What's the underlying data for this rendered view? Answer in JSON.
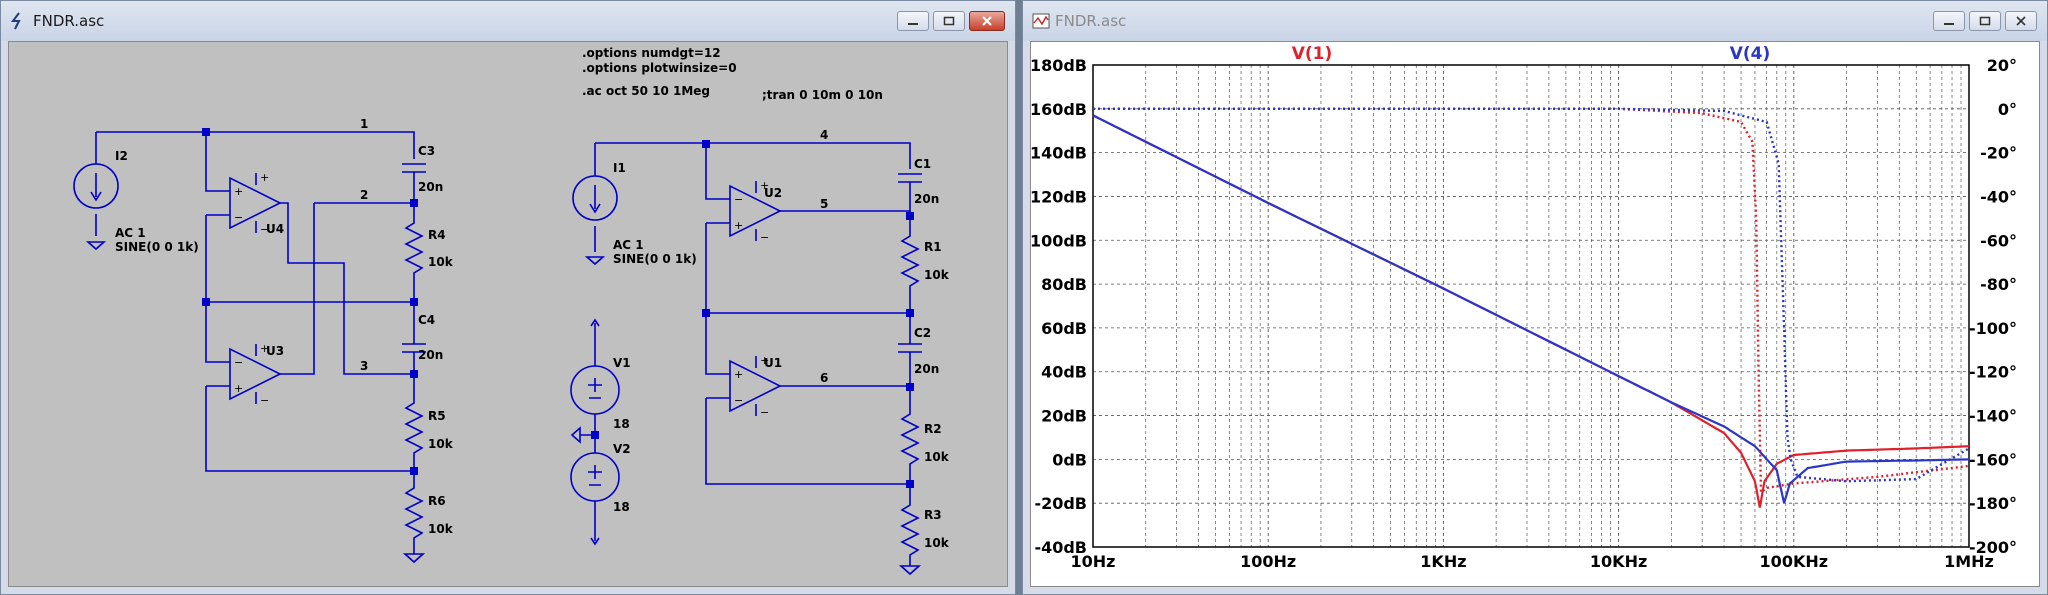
{
  "schematic_window": {
    "title": "FNDR.asc",
    "directives": [
      ".options numdgt=12",
      ".options plotwinsize=0",
      ".ac oct 50 10 1Meg",
      ";tran 0 10m 0 10n"
    ],
    "left_circuit": {
      "source": {
        "name": "I2",
        "line1": "AC 1",
        "line2": "SINE(0 0 1k)"
      },
      "opamps": [
        "U4",
        "U3"
      ],
      "components": [
        {
          "name": "C3",
          "value": "20n"
        },
        {
          "name": "R4",
          "value": "10k"
        },
        {
          "name": "C4",
          "value": "20n"
        },
        {
          "name": "R5",
          "value": "10k"
        },
        {
          "name": "R6",
          "value": "10k"
        }
      ],
      "nodes": [
        "1",
        "2",
        "3"
      ]
    },
    "right_circuit": {
      "source": {
        "name": "I1",
        "line1": "AC 1",
        "line2": "SINE(0 0 1k)"
      },
      "opamps": [
        "U2",
        "U1"
      ],
      "components": [
        {
          "name": "C1",
          "value": "20n"
        },
        {
          "name": "R1",
          "value": "10k"
        },
        {
          "name": "C2",
          "value": "20n"
        },
        {
          "name": "R2",
          "value": "10k"
        },
        {
          "name": "R3",
          "value": "10k"
        }
      ],
      "nodes": [
        "4",
        "5",
        "6"
      ]
    },
    "supplies": [
      {
        "name": "V1",
        "value": "18"
      },
      {
        "name": "V2",
        "value": "18"
      }
    ]
  },
  "plot_window": {
    "title": "FNDR.asc",
    "trace_labels": [
      {
        "name": "V(1)",
        "color": "#e0202a"
      },
      {
        "name": "V(4)",
        "color": "#2a36c8"
      }
    ],
    "chart_data": {
      "type": "line",
      "x_scale": "log",
      "xlim": [
        10,
        1000000
      ],
      "x_ticks": [
        "10Hz",
        "100Hz",
        "1KHz",
        "10KHz",
        "100KHz",
        "1MHz"
      ],
      "y_left": {
        "lim": [
          -40,
          180
        ],
        "unit": "dB",
        "ticks": [
          "180dB",
          "160dB",
          "140dB",
          "120dB",
          "100dB",
          "80dB",
          "60dB",
          "40dB",
          "20dB",
          "0dB",
          "-20dB",
          "-40dB"
        ]
      },
      "y_right": {
        "lim": [
          -200,
          20
        ],
        "unit": "°",
        "ticks": [
          "20°",
          "0°",
          "-20°",
          "-40°",
          "-60°",
          "-80°",
          "-100°",
          "-120°",
          "-140°",
          "-160°",
          "-180°",
          "-200°"
        ]
      },
      "grid": true,
      "series": [
        {
          "name": "V(1)",
          "axis": "left",
          "style": "solid",
          "color": "#e0202a",
          "x": [
            10,
            100,
            1000,
            10000,
            20000,
            40000,
            50000,
            60000,
            64000,
            68000,
            80000,
            100000,
            200000,
            500000,
            1000000
          ],
          "y": [
            157,
            117,
            78,
            38,
            26,
            12,
            3,
            -10,
            -22,
            -10,
            -2,
            2,
            4,
            5,
            6
          ]
        },
        {
          "name": "V(1)",
          "axis": "right",
          "style": "dotted",
          "color": "#e0202a",
          "x": [
            10,
            1000,
            10000,
            30000,
            50000,
            58000,
            61000,
            63000,
            65000,
            70000,
            100000,
            300000,
            1000000
          ],
          "y": [
            0,
            0,
            0,
            -2,
            -6,
            -15,
            -50,
            -120,
            -175,
            -173,
            -171,
            -168,
            -163
          ]
        },
        {
          "name": "V(4)",
          "axis": "left",
          "style": "solid",
          "color": "#2a36c8",
          "x": [
            10,
            100,
            1000,
            10000,
            20000,
            40000,
            60000,
            80000,
            88000,
            95000,
            120000,
            200000,
            500000,
            1000000
          ],
          "y": [
            157,
            117,
            78,
            38,
            26,
            15,
            6,
            -5,
            -20,
            -11,
            -4,
            -1,
            -0.5,
            0
          ]
        },
        {
          "name": "V(4)",
          "axis": "right",
          "style": "dotted",
          "color": "#2a36c8",
          "x": [
            10,
            1000,
            10000,
            40000,
            70000,
            82000,
            88000,
            92000,
            96000,
            105000,
            200000,
            500000,
            1000000
          ],
          "y": [
            0,
            0,
            0,
            -1,
            -6,
            -25,
            -100,
            -150,
            -160,
            -168,
            -170,
            -169,
            -155
          ]
        }
      ]
    }
  }
}
